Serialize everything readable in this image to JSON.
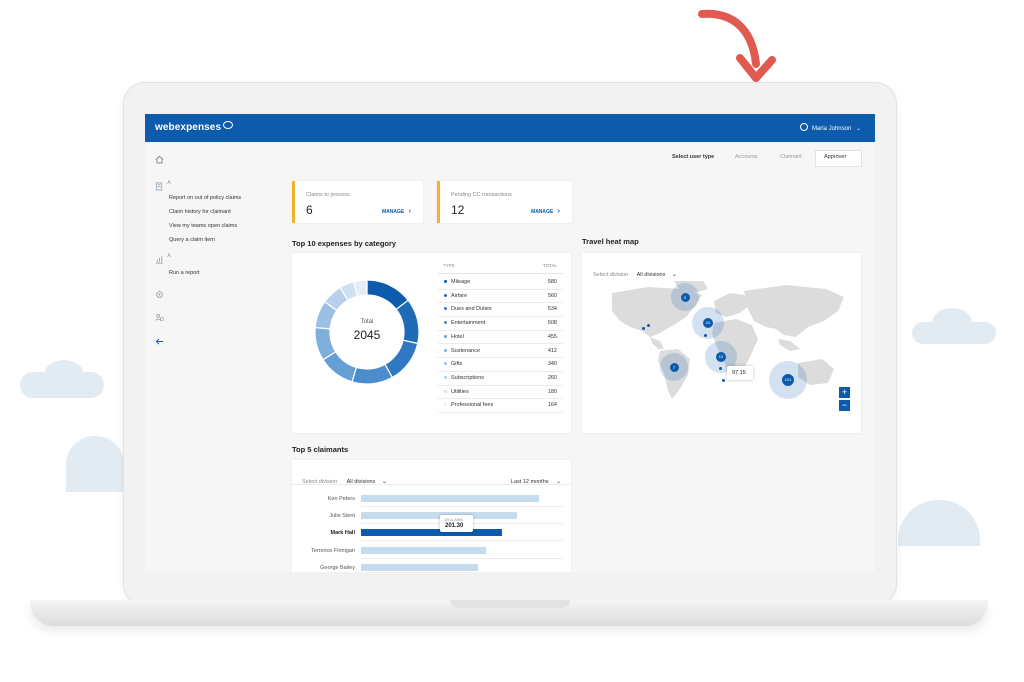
{
  "app": {
    "logo_text": "webexpenses",
    "user_name": "Maria Johnson"
  },
  "colors": {
    "brand": "#0c5bac",
    "kpi_accent": "#f0b429",
    "arrow": "#e05a4f"
  },
  "sidebar": {
    "sections": [
      {
        "icon": "home-icon"
      },
      {
        "icon": "claims-icon",
        "items": [
          "Report on out of policy claims",
          "Claim history for claimant",
          "View my teams open claims",
          "Query a claim item"
        ]
      },
      {
        "icon": "reports-icon",
        "items": [
          "Run a report"
        ]
      },
      {
        "icon": "settings-icon"
      },
      {
        "icon": "users-icon"
      },
      {
        "icon": "back-arrow-icon"
      }
    ]
  },
  "user_type": {
    "label": "Select user type",
    "options": [
      "Accounts",
      "Claimant",
      "Approver"
    ],
    "selected": "Approver"
  },
  "kpis": [
    {
      "label": "Claims to process",
      "value": "6",
      "action": "MANAGE"
    },
    {
      "label": "Pending CC transactions",
      "value": "12",
      "action": "MANAGE"
    }
  ],
  "expenses": {
    "title": "Top 10 expenses by category",
    "total_label": "Total",
    "total_value": "2045",
    "col_type": "TYPE",
    "col_total": "TOTAL",
    "rows": [
      {
        "type": "Mileage",
        "total": "580",
        "color": "#0c5bac"
      },
      {
        "type": "Airfare",
        "total": "560",
        "color": "#1f6bb8"
      },
      {
        "type": "Dues and Duties",
        "total": "534",
        "color": "#2f79c2"
      },
      {
        "type": "Entertainment",
        "total": "508",
        "color": "#4a8ccc"
      },
      {
        "type": "Hotel",
        "total": "455",
        "color": "#669fd6"
      },
      {
        "type": "Sustenance",
        "total": "412",
        "color": "#7fafdc"
      },
      {
        "type": "Gifts",
        "total": "340",
        "color": "#9cc0e4"
      },
      {
        "type": "Subscriptions",
        "total": "260",
        "color": "#b7d1ec"
      },
      {
        "type": "Utilities",
        "total": "180",
        "color": "#cfe0f2"
      },
      {
        "type": "Professional fees",
        "total": "164",
        "color": "#e3edf7"
      }
    ]
  },
  "heatmap": {
    "title": "Travel heat map",
    "division_label": "Select division",
    "division_value": "All divisions",
    "clusters": [
      {
        "label": "9"
      },
      {
        "label": "24"
      },
      {
        "label": "12"
      },
      {
        "label": "7"
      },
      {
        "label": "101"
      }
    ],
    "tooltip_value": "97.15",
    "zoom_in": "+",
    "zoom_out": "−"
  },
  "claimants": {
    "title": "Top 5 claimants",
    "division_label": "Select division",
    "division_value": "All divisions",
    "period": "Last 12 months",
    "max": 100,
    "rows": [
      {
        "name": "Ken Peters",
        "value": 88
      },
      {
        "name": "Julie Stent",
        "value": 77
      },
      {
        "name": "Mark Hall",
        "value": 70
      },
      {
        "name": "Terrence Finnigan",
        "value": 62
      },
      {
        "name": "George Bailey",
        "value": 58
      }
    ],
    "highlight_index": 2,
    "tooltip_label": "£5 CLAIMS",
    "tooltip_value": "201.30"
  }
}
